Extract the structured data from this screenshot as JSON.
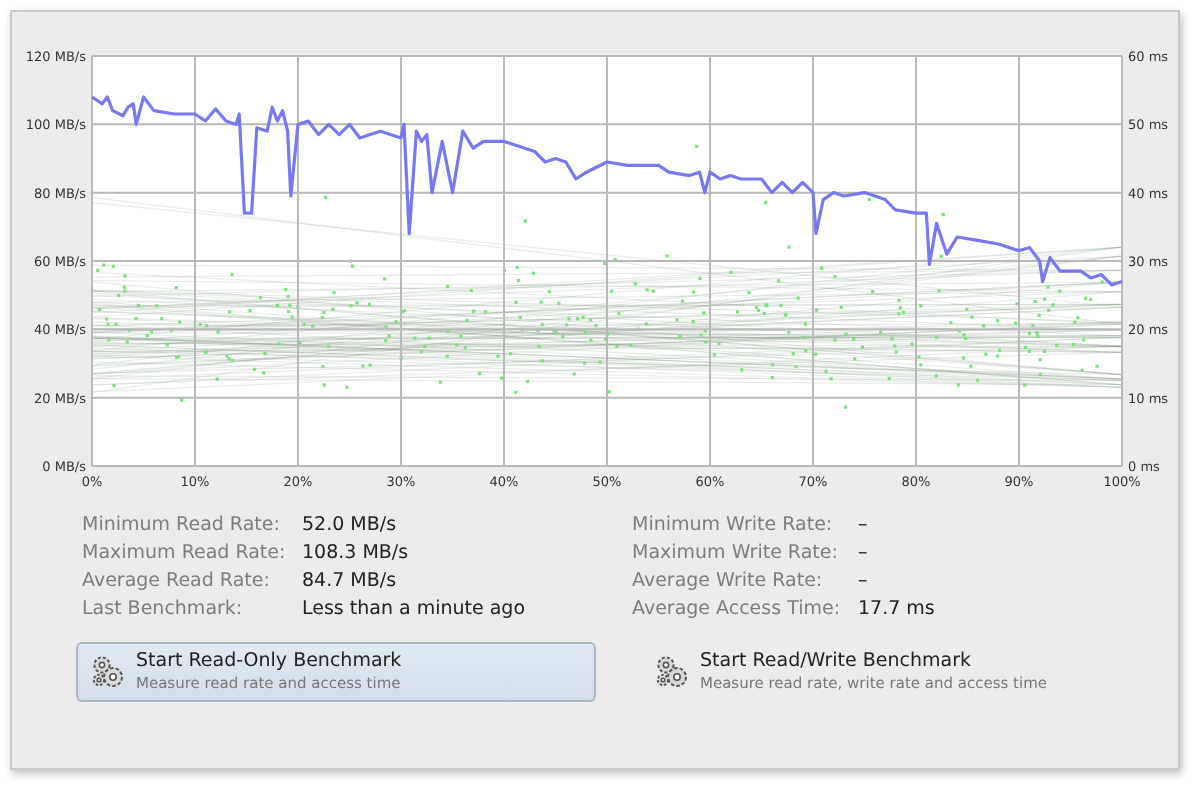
{
  "chart": {
    "chart_data": {
      "type": "line",
      "x": [
        0,
        1,
        1.5,
        2,
        3,
        3.5,
        4,
        4.3,
        5,
        6,
        8,
        10,
        11,
        12,
        13,
        14,
        14.3,
        14.8,
        15.5,
        16,
        17,
        17.5,
        18,
        18.5,
        19,
        19.3,
        20,
        21,
        22,
        23,
        24,
        25,
        26,
        27,
        28,
        30,
        30.3,
        30.8,
        31.5,
        32,
        32.5,
        33,
        34,
        35,
        36,
        37,
        38,
        40,
        41,
        43,
        44,
        45,
        46,
        47,
        48,
        50,
        52,
        55,
        56,
        58,
        59,
        59.5,
        60,
        61,
        62,
        63,
        65,
        66,
        67,
        68,
        69,
        70,
        70.3,
        71,
        72,
        73,
        75,
        77,
        78,
        80,
        81,
        81.3,
        82,
        83,
        84,
        86,
        88,
        90,
        91,
        92,
        92.3,
        93,
        94,
        96,
        97,
        98,
        99,
        100
      ],
      "grid": true,
      "series": [
        {
          "color": "#7878f4",
          "values": [
            108,
            106,
            108,
            104,
            102.5,
            105,
            106,
            100,
            108,
            104,
            103,
            103,
            101,
            104.5,
            101,
            100,
            103,
            74,
            74,
            99,
            98,
            105,
            101,
            104,
            98,
            79,
            100,
            101,
            97,
            100,
            97,
            100,
            96,
            97,
            98,
            96,
            100,
            68,
            98,
            95,
            97,
            80,
            95,
            80,
            98,
            93,
            95,
            95,
            94,
            92,
            89,
            90,
            89,
            84,
            86,
            89,
            88,
            88,
            86,
            85,
            86,
            80,
            86,
            84,
            85,
            84,
            84,
            80,
            83,
            80,
            83,
            80,
            68,
            78,
            80,
            79,
            80,
            78,
            75,
            74,
            74,
            59,
            71,
            62,
            67,
            66,
            65,
            63,
            64,
            60,
            54,
            61,
            57,
            57,
            55,
            56,
            53,
            54
          ]
        }
      ],
      "xlim": [
        0,
        100
      ],
      "ylim": [
        0,
        120
      ],
      "xticks": [
        {
          "value": 0,
          "label": "0%"
        },
        {
          "value": 10,
          "label": "10%"
        },
        {
          "value": 20,
          "label": "20%"
        },
        {
          "value": 30,
          "label": "30%"
        },
        {
          "value": 40,
          "label": "40%"
        },
        {
          "value": 50,
          "label": "50%"
        },
        {
          "value": 60,
          "label": "60%"
        },
        {
          "value": 70,
          "label": "70%"
        },
        {
          "value": 80,
          "label": "80%"
        },
        {
          "value": 90,
          "label": "90%"
        },
        {
          "value": 100,
          "label": "100%"
        }
      ],
      "yticks": [
        {
          "value": 0,
          "label": "0 MB/s"
        },
        {
          "value": 20,
          "label": "20 MB/s"
        },
        {
          "value": 40,
          "label": "40 MB/s"
        },
        {
          "value": 60,
          "label": "60 MB/s"
        },
        {
          "value": 80,
          "label": "80 MB/s"
        },
        {
          "value": 100,
          "label": "100 MB/s"
        },
        {
          "value": 120,
          "label": "120 MB/s"
        }
      ]
    },
    "right_axis_labels": [
      "60 ms",
      "50 ms",
      "40 ms",
      "30 ms",
      "20 ms",
      "10 ms",
      "0 ms"
    ]
  },
  "read_stats": [
    {
      "label": "Minimum Read Rate:",
      "value": "52.0 MB/s"
    },
    {
      "label": "Maximum Read Rate:",
      "value": "108.3 MB/s"
    },
    {
      "label": "Average Read Rate:",
      "value": "84.7 MB/s"
    },
    {
      "label": "Last Benchmark:",
      "value": "Less than a minute ago"
    }
  ],
  "write_stats": [
    {
      "label": "Minimum Write Rate:",
      "value": "–"
    },
    {
      "label": "Maximum Write Rate:",
      "value": "–"
    },
    {
      "label": "Average Write Rate:",
      "value": "–"
    },
    {
      "label": "Average Access Time:",
      "value": "17.7 ms"
    }
  ],
  "buttons": [
    {
      "title": "Start Read-Only Benchmark",
      "description": "Measure read rate and access time",
      "highlighted": true
    },
    {
      "title": "Start Read/Write Benchmark",
      "description": "Measure read rate, write rate and access time",
      "highlighted": false
    }
  ]
}
